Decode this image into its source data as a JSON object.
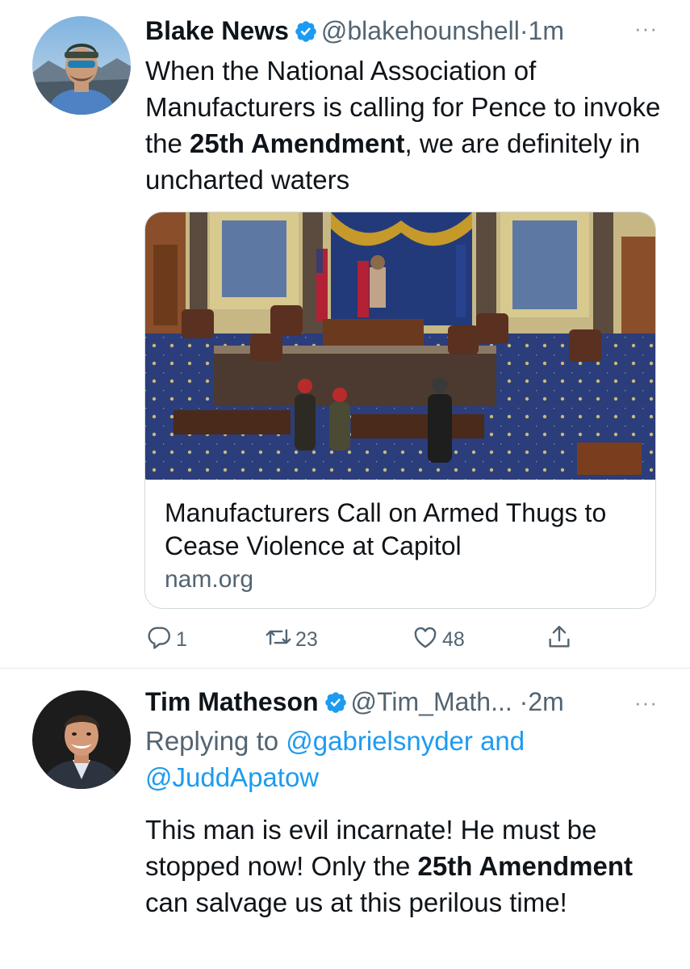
{
  "tweets": [
    {
      "display_name": "Blake News",
      "handle": "@blakehounshell",
      "separator": "·",
      "time": "1m",
      "more": "···",
      "text": [
        {
          "t": "When the National Association of Manufacturers is calling for Pence to invoke the ",
          "bold": false
        },
        {
          "t": "25th Amendment",
          "bold": true
        },
        {
          "t": ", we are definitely in uncharted waters",
          "bold": false
        }
      ],
      "card": {
        "title": "Manufacturers Call on Armed Thugs to Cease Violence at Capitol",
        "domain": "nam.org"
      },
      "actions": {
        "replies": "1",
        "retweets": "23",
        "likes": "48"
      }
    },
    {
      "display_name": "Tim Matheson",
      "handle": "@Tim_Math...",
      "separator": "·",
      "time": "2m",
      "more": "···",
      "replying_to": {
        "prefix": "Replying to",
        "mention1": "@gabrielsnyder",
        "joiner": "and",
        "mention2": "@JuddApatow"
      },
      "text": [
        {
          "t": "This man is evil incarnate!  He must be stopped now!  Only the ",
          "bold": false
        },
        {
          "t": "25th Amendment",
          "bold": true
        },
        {
          "t": " can salvage us at this perilous time!",
          "bold": false
        }
      ]
    }
  ],
  "colors": {
    "text": "#0f1419",
    "secondary": "#536471",
    "link": "#1d9bf0",
    "verified": "#1d9bf0",
    "border": "#cfd9de"
  },
  "icons": [
    "verified-badge-icon",
    "more-icon",
    "reply-icon",
    "retweet-icon",
    "like-icon",
    "share-icon"
  ]
}
